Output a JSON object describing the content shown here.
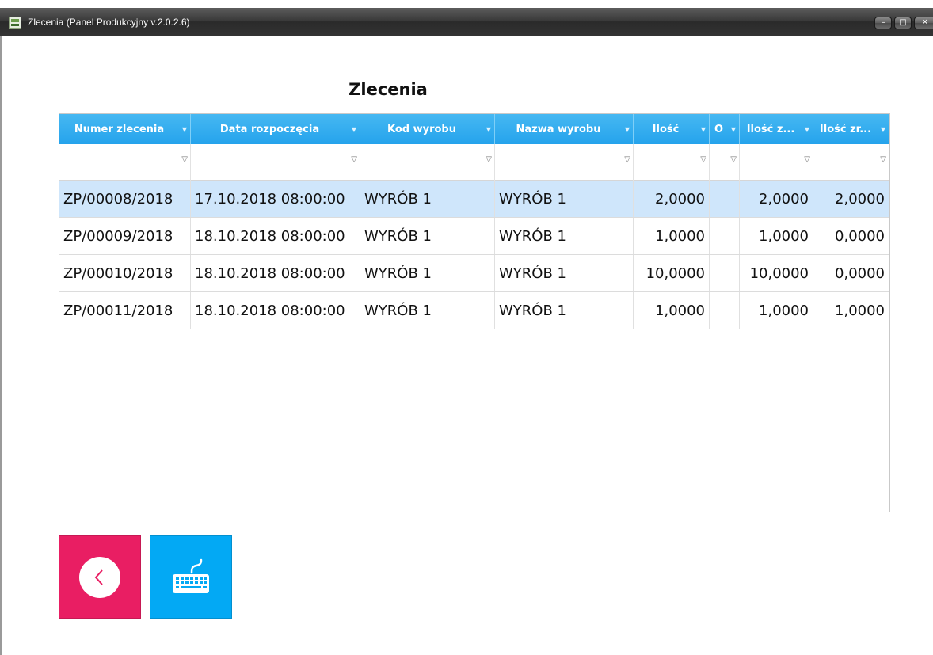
{
  "window": {
    "title": "Zlecenia (Panel Produkcyjny v.2.0.2.6)",
    "min_glyph": "–",
    "max_glyph": "□",
    "close_glyph": "✕"
  },
  "page": {
    "heading": "Zlecenia"
  },
  "grid": {
    "filter_glyph": "▼",
    "filter_row_glyph": "▽",
    "columns": [
      "Numer zlecenia",
      "Data rozpoczęcia",
      "Kod wyrobu",
      "Nazwa wyrobu",
      "Ilość",
      "O",
      "Ilość z...",
      "Ilość zr..."
    ],
    "rows": [
      [
        "ZP/00008/2018",
        "17.10.2018 08:00:00",
        "WYRÓB 1",
        "WYRÓB 1",
        "2,0000",
        "",
        "2,0000",
        "2,0000"
      ],
      [
        "ZP/00009/2018",
        "18.10.2018 08:00:00",
        "WYRÓB 1",
        "WYRÓB 1",
        "1,0000",
        "",
        "1,0000",
        "0,0000"
      ],
      [
        "ZP/00010/2018",
        "18.10.2018 08:00:00",
        "WYRÓB 1",
        "WYRÓB 1",
        "10,0000",
        "",
        "10,0000",
        "0,0000"
      ],
      [
        "ZP/00011/2018",
        "18.10.2018 08:00:00",
        "WYRÓB 1",
        "WYRÓB 1",
        "1,0000",
        "",
        "1,0000",
        "1,0000"
      ]
    ],
    "selected_row": 0
  },
  "buttons": {
    "back_icon": "chevron-left-icon",
    "keyboard_icon": "keyboard-icon"
  },
  "colors": {
    "header_blue": "#25a3ec",
    "selected_row": "#cfe6fb",
    "back_button": "#e91e63",
    "keyboard_button": "#03a9f4"
  }
}
